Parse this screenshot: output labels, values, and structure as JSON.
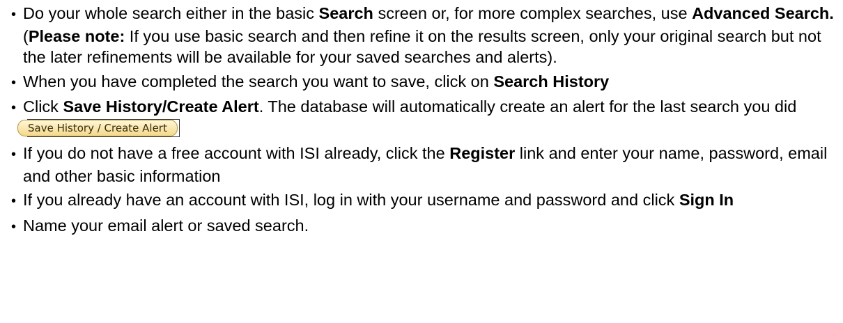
{
  "items": [
    {
      "parts": [
        {
          "t": "Do your whole search either in the basic ",
          "b": false
        },
        {
          "t": "Search",
          "b": true
        },
        {
          "t": " screen or, for more complex searches, use ",
          "b": false
        },
        {
          "t": "Advanced Search.",
          "b": true
        },
        {
          "t": " (",
          "b": false
        },
        {
          "t": "Please note:",
          "b": true
        },
        {
          "t": " If you use basic search and then refine it on the results screen, only your original search but not the later refinements will be available for your saved searches and alerts).",
          "b": false
        }
      ]
    },
    {
      "parts": [
        {
          "t": "When you have completed the search you want to save, click on ",
          "b": false
        },
        {
          "t": "Search History",
          "b": true
        }
      ]
    },
    {
      "parts": [
        {
          "t": "Click ",
          "b": false
        },
        {
          "t": "Save History/Create Alert",
          "b": true
        },
        {
          "t": ". The database will automatically create an alert for the last search you did",
          "b": false
        }
      ],
      "button_label": "Save History / Create Alert"
    },
    {
      "parts": [
        {
          "t": "If you do not have a free account with ISI already, click the ",
          "b": false
        },
        {
          "t": "Register",
          "b": true
        },
        {
          "t": " link and enter your name, password, email and other basic information",
          "b": false
        }
      ]
    },
    {
      "parts": [
        {
          "t": "If you already have an account with ISI, log in with your username and password and click ",
          "b": false
        },
        {
          "t": "Sign In",
          "b": true
        }
      ]
    },
    {
      "parts": [
        {
          "t": "Name your email alert or saved search.",
          "b": false
        }
      ]
    }
  ]
}
